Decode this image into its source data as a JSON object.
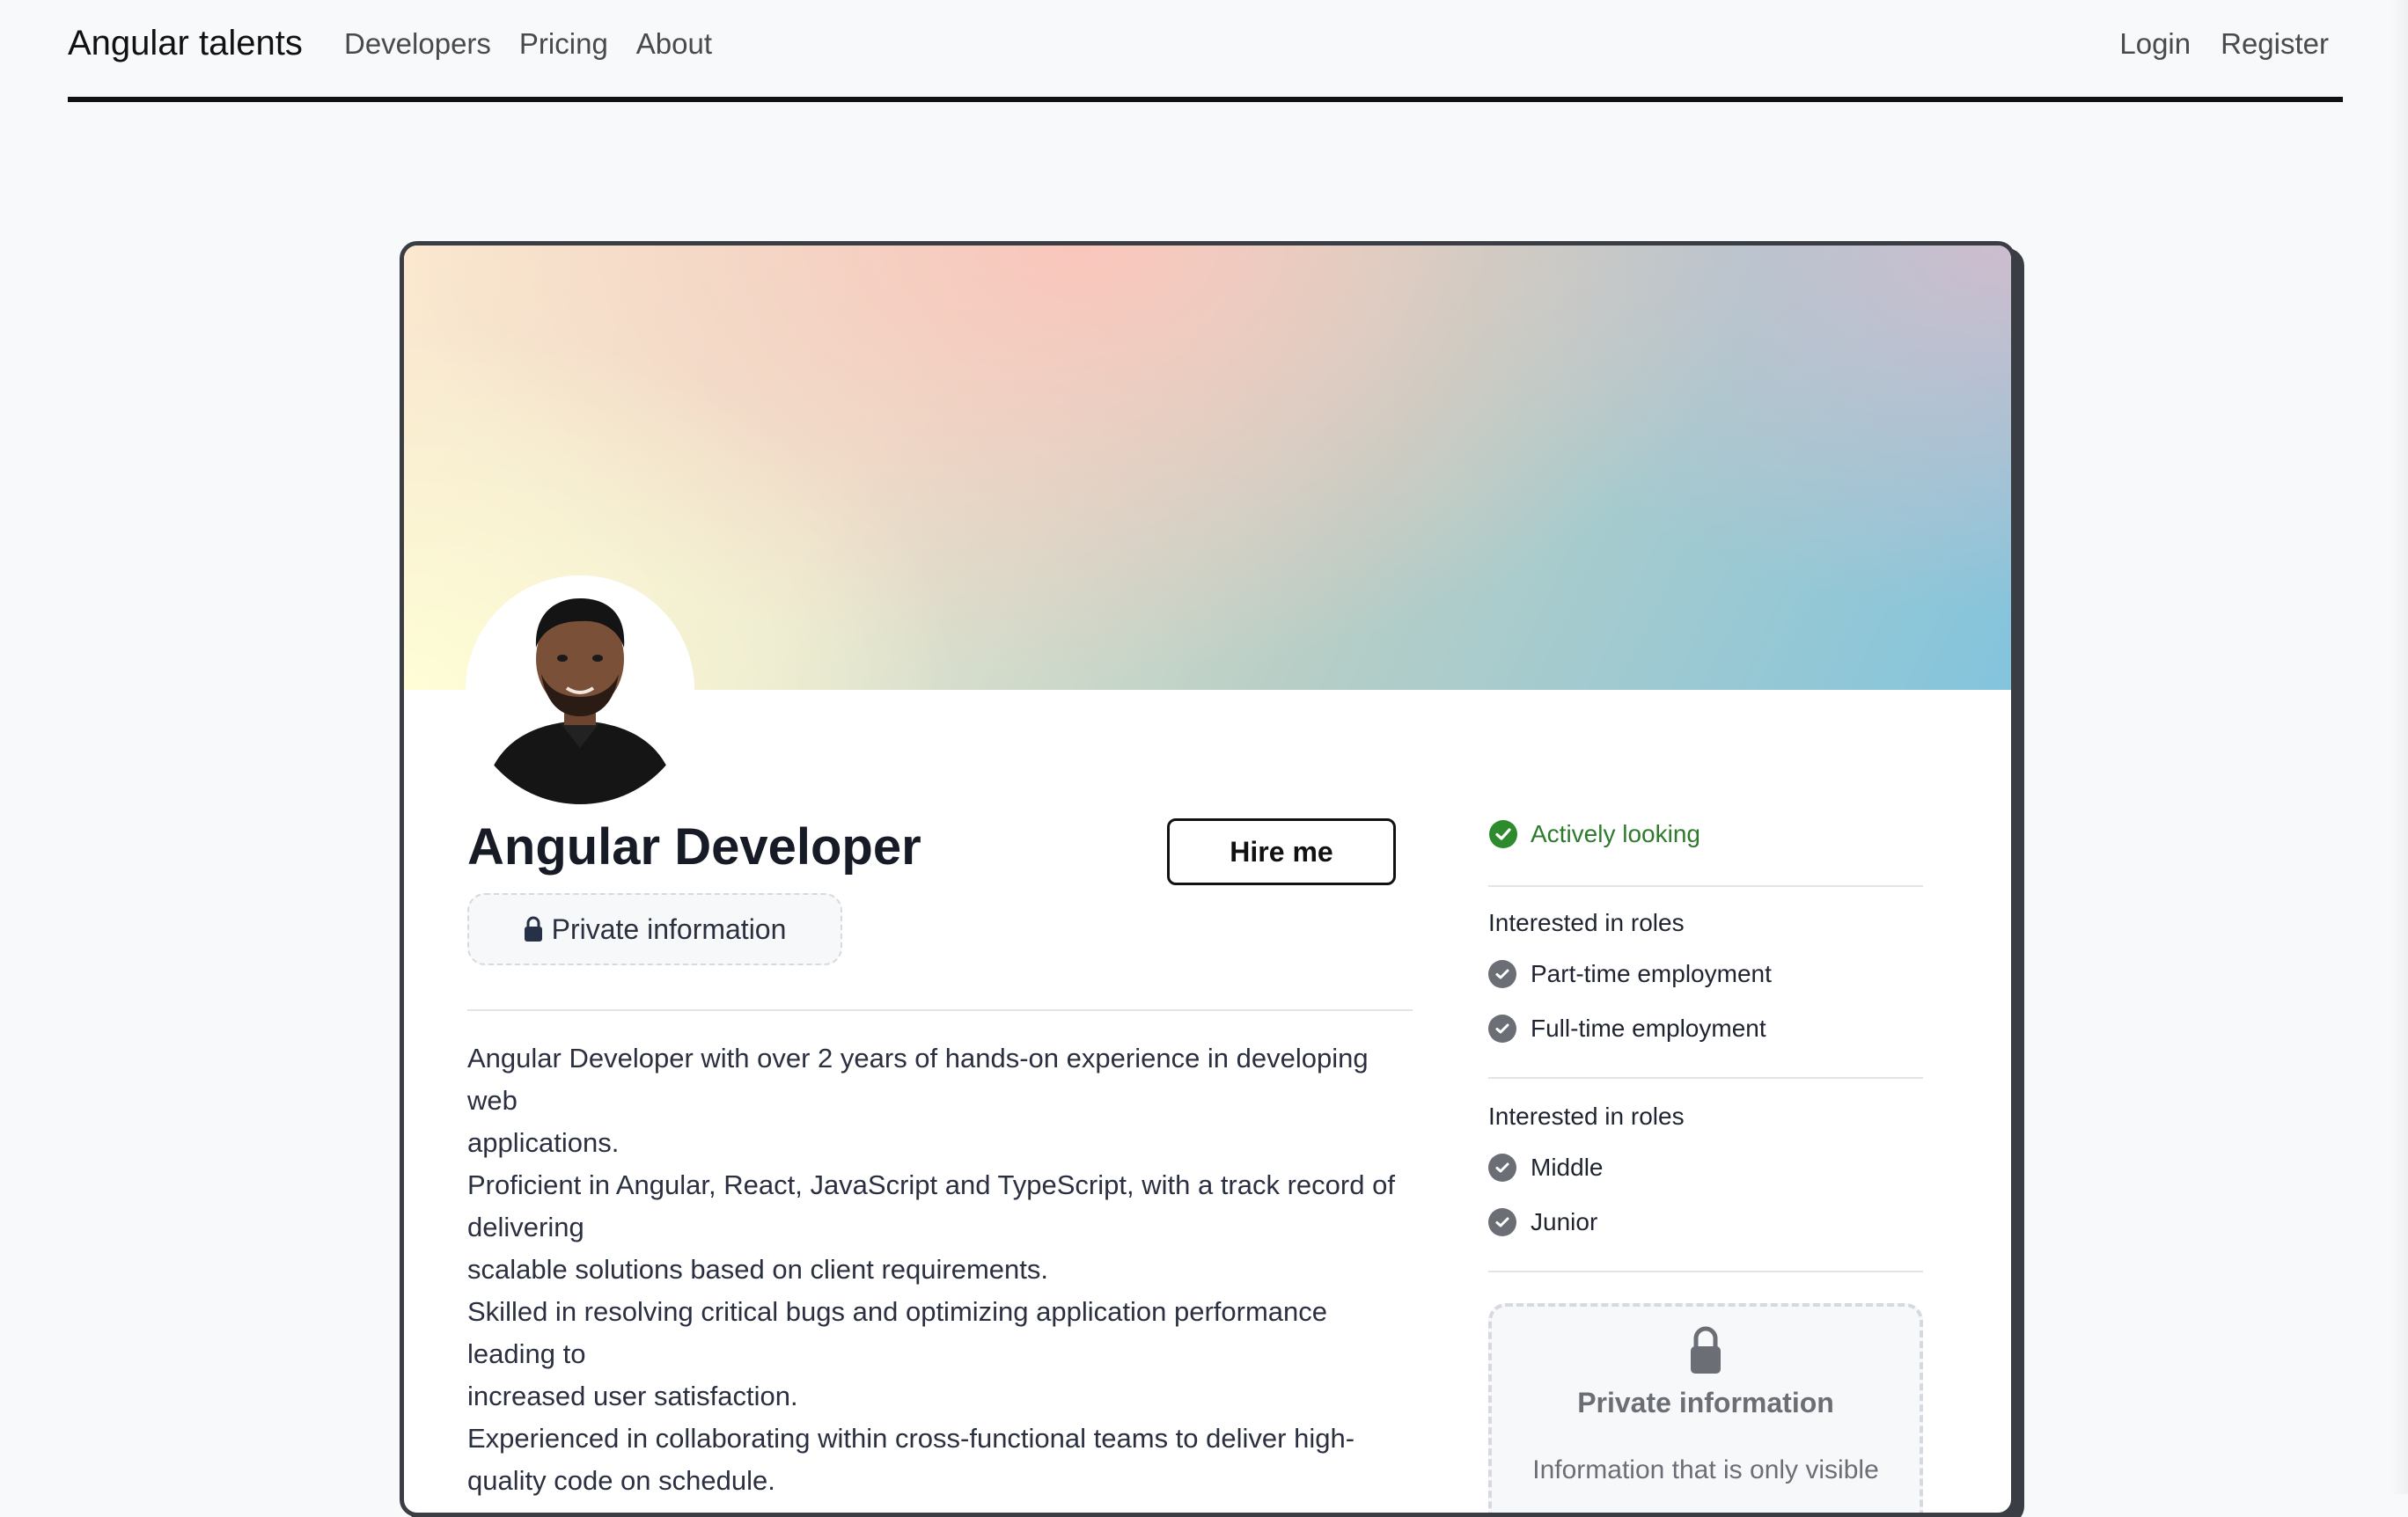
{
  "nav": {
    "brand": "Angular talents",
    "links": [
      "Developers",
      "Pricing",
      "About"
    ],
    "auth": [
      "Login",
      "Register"
    ]
  },
  "profile": {
    "title": "Angular Developer",
    "hire_label": "Hire me",
    "private_label": "Private information",
    "bio": [
      "Angular Developer with over 2 years of hands-on experience in developing web",
      "applications.",
      "Proficient in Angular, React, JavaScript and TypeScript, with a track record of delivering",
      "scalable solutions based on client requirements.",
      "Skilled in resolving critical bugs and optimizing application performance leading to",
      "increased user satisfaction.",
      "Experienced in collaborating within cross-functional teams to deliver high-quality code on schedule."
    ]
  },
  "sidebar": {
    "status": "Actively looking",
    "employment_title": "Interested in roles",
    "employment": [
      "Part-time employment",
      "Full-time employment"
    ],
    "level_title": "Interested in roles",
    "levels": [
      "Middle",
      "Junior"
    ],
    "private_title": "Private information",
    "private_desc": "Information that is only visible"
  },
  "colors": {
    "accent_green": "#2d7a2d",
    "border_dark": "#3a3d44"
  }
}
